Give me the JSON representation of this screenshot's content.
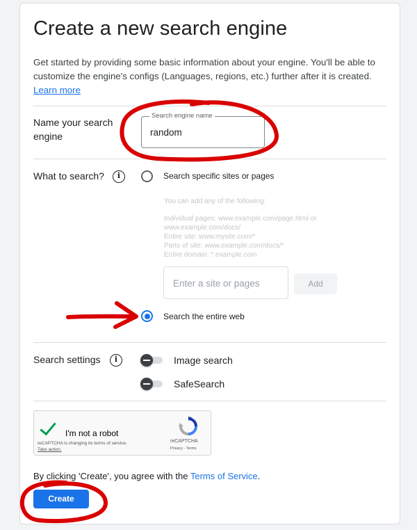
{
  "page": {
    "title": "Create a new search engine",
    "intro": "Get started by providing some basic information about your engine. You'll be able to customize the engine's configs (Languages, regions, etc.) further after it is created.",
    "learn_more": "Learn more"
  },
  "name_section": {
    "label": "Name your search engine",
    "field_legend": "Search engine name",
    "field_value": "random"
  },
  "what_section": {
    "label": "What to search?",
    "option_specific": "Search specific sites or pages",
    "hint_title": "You can add any of the following:",
    "hint_lines": [
      "Individual pages: www.example.com/page.html or",
      "www.example.com/docs/",
      "Entire site: www.mysite.com/*",
      "Parts of site: www.example.com/docs/*",
      "Entire domain: *.example.com"
    ],
    "site_input_placeholder": "Enter a site or pages",
    "add_button": "Add",
    "option_entire_web": "Search the entire web",
    "selected": "entire_web"
  },
  "settings_section": {
    "label": "Search settings",
    "image_search": {
      "label": "Image search",
      "enabled": false
    },
    "safe_search": {
      "label": "SafeSearch",
      "enabled": false
    }
  },
  "captcha": {
    "label": "I'm not a robot",
    "note": "reCAPTCHA is changing its terms of service.",
    "note_action": "Take action.",
    "brand": "reCAPTCHA",
    "links": "Privacy - Terms",
    "checked": true
  },
  "footer": {
    "terms_prefix": "By clicking 'Create', you agree with the",
    "terms_link": "Terms of Service",
    "terms_suffix": ".",
    "create_button": "Create"
  },
  "colors": {
    "accent": "#1a73e8",
    "annotation": "#d90000",
    "check": "#009e55"
  }
}
